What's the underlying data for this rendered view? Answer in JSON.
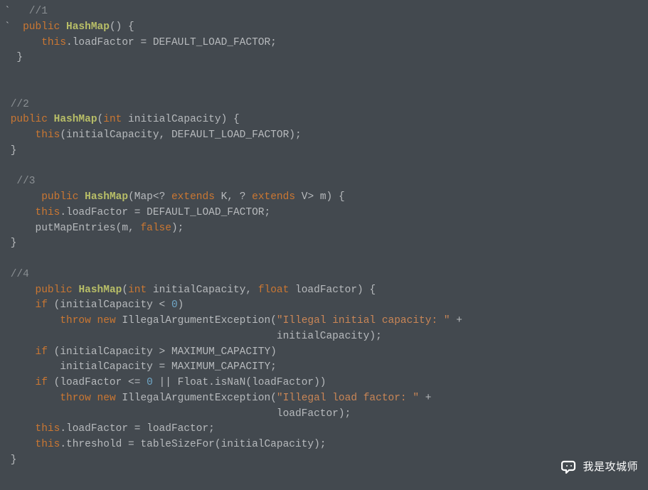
{
  "code": {
    "c1_backtick": "` ",
    "c1_comment": "  //1",
    "c1_backtick2": "` ",
    "c1_kw_public": " public",
    "c1_sp1": " ",
    "c1_type": "HashMap",
    "c1_rest1": "() {",
    "c1_body_indent": "      ",
    "c1_kw_this": "this",
    "c1_body_rest": ".loadFactor = DEFAULT_LOAD_FACTOR;",
    "c1_close": "  }",
    "c2_comment": " //2",
    "c2_indent": " ",
    "c2_kw_public": "public",
    "c2_sp1": " ",
    "c2_type": "HashMap",
    "c2_open": "(",
    "c2_kw_int": "int",
    "c2_rest1": " initialCapacity) {",
    "c2_body_indent": "     ",
    "c2_kw_this": "this",
    "c2_body_rest": "(initialCapacity, DEFAULT_LOAD_FACTOR);",
    "c2_close": " }",
    "c3_comment": "  //3",
    "c3_indent": "      ",
    "c3_kw_public": "public",
    "c3_sp1": " ",
    "c3_type": "HashMap",
    "c3_open": "(Map<? ",
    "c3_kw_extends1": "extends",
    "c3_m1": " K, ? ",
    "c3_kw_extends2": "extends",
    "c3_rest1": " V> m) {",
    "c3_body1_indent": "     ",
    "c3_kw_this": "this",
    "c3_body1_rest": ".loadFactor = DEFAULT_LOAD_FACTOR;",
    "c3_body2": "     putMapEntries(m, ",
    "c3_kw_false": "false",
    "c3_body2_end": ");",
    "c3_close": " }",
    "c4_comment": " //4",
    "c4_indent": "     ",
    "c4_kw_public": "public",
    "c4_sp1": " ",
    "c4_type": "HashMap",
    "c4_open": "(",
    "c4_kw_int": "int",
    "c4_m1": " initialCapacity, ",
    "c4_kw_float": "float",
    "c4_rest1": " loadFactor) {",
    "c4_l2_indent": "     ",
    "c4_kw_if1": "if",
    "c4_l2_rest": " (initialCapacity < ",
    "c4_num0a": "0",
    "c4_l2_end": ")",
    "c4_l3_indent": "         ",
    "c4_kw_throw1": "throw",
    "c4_sp_t1": " ",
    "c4_kw_new1": "new",
    "c4_l3_rest": " IllegalArgumentException(",
    "c4_str1": "\"Illegal initial capacity: \"",
    "c4_l3_plus": " +",
    "c4_l4": "                                            initialCapacity);",
    "c4_l5_indent": "     ",
    "c4_kw_if2": "if",
    "c4_l5_rest": " (initialCapacity > MAXIMUM_CAPACITY)",
    "c4_l6": "         initialCapacity = MAXIMUM_CAPACITY;",
    "c4_l7_indent": "     ",
    "c4_kw_if3": "if",
    "c4_l7_rest": " (loadFactor <= ",
    "c4_num0b": "0",
    "c4_l7_or": " || Float.isNaN(loadFactor))",
    "c4_l8_indent": "         ",
    "c4_kw_throw2": "throw",
    "c4_sp_t2": " ",
    "c4_kw_new2": "new",
    "c4_l8_rest": " IllegalArgumentException(",
    "c4_str2": "\"Illegal load factor: \"",
    "c4_l8_plus": " +",
    "c4_l9": "                                            loadFactor);",
    "c4_l10_indent": "     ",
    "c4_kw_this2": "this",
    "c4_l10_rest": ".loadFactor = loadFactor;",
    "c4_l11_indent": "     ",
    "c4_kw_this3": "this",
    "c4_l11_rest": ".threshold = tableSizeFor(initialCapacity);",
    "c4_close": " }"
  },
  "watermark": {
    "text": "我是攻城师"
  }
}
